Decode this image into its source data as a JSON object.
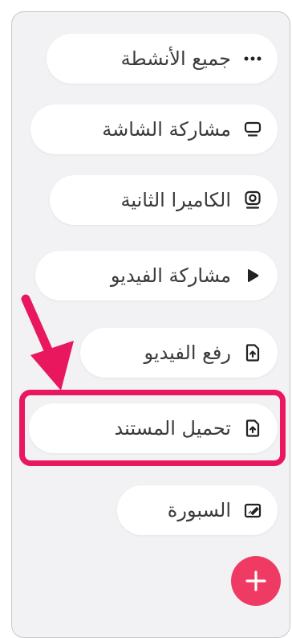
{
  "menu": {
    "items": [
      {
        "label": "جميع الأنشطة",
        "icon": "more-dots-icon"
      },
      {
        "label": "مشاركة الشاشة",
        "icon": "monitor-icon"
      },
      {
        "label": "الكاميرا الثانية",
        "icon": "webcam-icon"
      },
      {
        "label": "مشاركة الفيديو",
        "icon": "play-icon"
      },
      {
        "label": "رفع الفيديو",
        "icon": "upload-file-icon"
      },
      {
        "label": "تحميل المستند",
        "icon": "upload-file-icon"
      },
      {
        "label": "السبورة",
        "icon": "whiteboard-icon"
      }
    ]
  },
  "fab": {
    "icon": "plus-icon"
  },
  "annotation": {
    "highlight_color": "#e9185e",
    "target_item": "تحميل المستند"
  }
}
